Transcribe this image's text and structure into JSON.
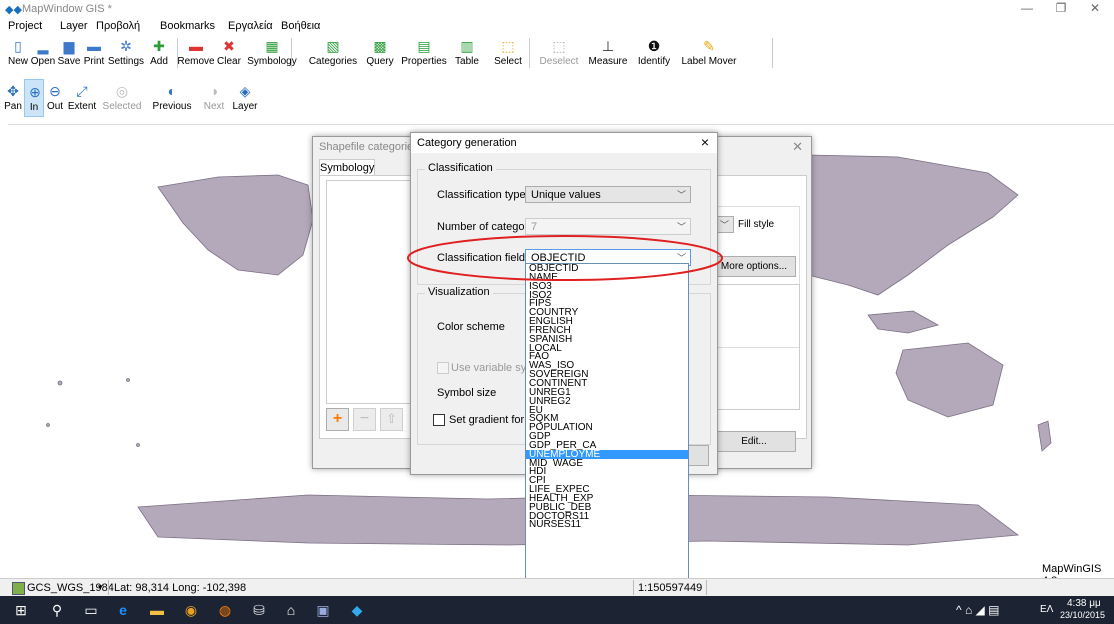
{
  "window": {
    "title": "MapWindow GIS *"
  },
  "menu": [
    "Project",
    "Layer",
    "Προβολή",
    "Bookmarks",
    "Εργαλεία",
    "Βοήθεια"
  ],
  "toolbar1": [
    {
      "label": "New",
      "icon": "new-file-icon",
      "glyph": "▯"
    },
    {
      "label": "Open",
      "icon": "open-folder-icon",
      "glyph": "▂"
    },
    {
      "label": "Save",
      "icon": "save-icon",
      "glyph": "▆"
    },
    {
      "label": "Print",
      "icon": "print-icon",
      "glyph": "▬"
    },
    {
      "label": "Settings",
      "icon": "gear-icon",
      "glyph": "✲"
    },
    {
      "label": "Add",
      "icon": "add-layer-icon",
      "glyph": "✚"
    },
    {
      "label": "Remove",
      "icon": "remove-layer-icon",
      "glyph": "▬"
    },
    {
      "label": "Clear",
      "icon": "clear-layers-icon",
      "glyph": "✖"
    },
    {
      "label": "Symbology",
      "icon": "symbology-icon",
      "glyph": "▦"
    },
    {
      "label": "Categories",
      "icon": "categories-icon",
      "glyph": "▧"
    },
    {
      "label": "Query",
      "icon": "query-icon",
      "glyph": "▩"
    },
    {
      "label": "Properties",
      "icon": "properties-icon",
      "glyph": "▤"
    },
    {
      "label": "Table",
      "icon": "table-icon",
      "glyph": "▥"
    },
    {
      "label": "Select",
      "icon": "select-icon",
      "glyph": "⬚"
    },
    {
      "label": "Deselect",
      "icon": "deselect-icon",
      "glyph": "⬚"
    },
    {
      "label": "Measure",
      "icon": "measure-icon",
      "glyph": "⊥"
    },
    {
      "label": "Identify",
      "icon": "identify-icon",
      "glyph": "❶"
    },
    {
      "label": "Label Mover",
      "icon": "label-mover-icon",
      "glyph": "✎"
    }
  ],
  "toolbar2": [
    {
      "label": "Pan",
      "icon": "pan-icon",
      "glyph": "✥"
    },
    {
      "label": "In",
      "icon": "zoom-in-icon",
      "glyph": "⊕"
    },
    {
      "label": "Out",
      "icon": "zoom-out-icon",
      "glyph": "⊖"
    },
    {
      "label": "Extent",
      "icon": "zoom-extent-icon",
      "glyph": "⤢"
    },
    {
      "label": "Selected",
      "icon": "zoom-selected-icon",
      "glyph": "◎"
    },
    {
      "label": "Previous",
      "icon": "zoom-previous-icon",
      "glyph": "◐"
    },
    {
      "label": "Next",
      "icon": "zoom-next-icon",
      "glyph": "◑"
    },
    {
      "label": "Layer",
      "icon": "zoom-layer-icon",
      "glyph": "◈"
    }
  ],
  "map": {
    "watermark": "MapWinGIS 4.8"
  },
  "status": {
    "projection": "GCS_WGS_1984",
    "coords": "Lat: 98,314 Long: -102,398",
    "scale": "1:150597449"
  },
  "taskbar": {
    "time": "4:38 μμ",
    "date": "23/10/2015",
    "lang": "ΕΛ"
  },
  "shapefile_dialog": {
    "title": "Shapefile categories",
    "tab": "Symbology",
    "fill_style": "Fill style",
    "more_options": "More options...",
    "edit": "Edit...",
    "add_glyph": "+",
    "remove_glyph": "−",
    "up_glyph": "⇧"
  },
  "category_dialog": {
    "title": "Category generation",
    "classification_group": "Classification",
    "classification_type_label": "Classification type",
    "classification_type_value": "Unique values",
    "num_categories_label": "Number of categories",
    "num_categories_value": "7",
    "classification_field_label": "Classification field",
    "classification_field_value": "OBJECTID",
    "visualization_group": "Visualization",
    "color_scheme_label": "Color scheme",
    "use_variable_label": "Use variable symbol",
    "symbol_size_label": "Symbol size",
    "gradient_label": "Set gradient for each",
    "cancel": "Cancel",
    "close_glyph": "×"
  },
  "field_options": [
    "OBJECTID",
    "NAME",
    "ISO3",
    "ISO2",
    "FIPS",
    "COUNTRY",
    "ENGLISH",
    "FRENCH",
    "SPANISH",
    "LOCAL",
    "FAO",
    "WAS_ISO",
    "SOVEREIGN",
    "CONTINENT",
    "UNREG1",
    "UNREG2",
    "EU",
    "SQKM",
    "POPULATION",
    "GDP",
    "GDP_PER_CA",
    "UNEMPLOYME",
    "MID_WAGE",
    "HDI",
    "CPI",
    "LIFE_EXPEC",
    "HEALTH_EXP",
    "PUBLIC_DEB",
    "DOCTORS11",
    "NURSES11"
  ],
  "selected_option": 21,
  "colors": {
    "highlight": "#3399ff",
    "annotation": "#e02020",
    "land": "#b3a9bb"
  }
}
